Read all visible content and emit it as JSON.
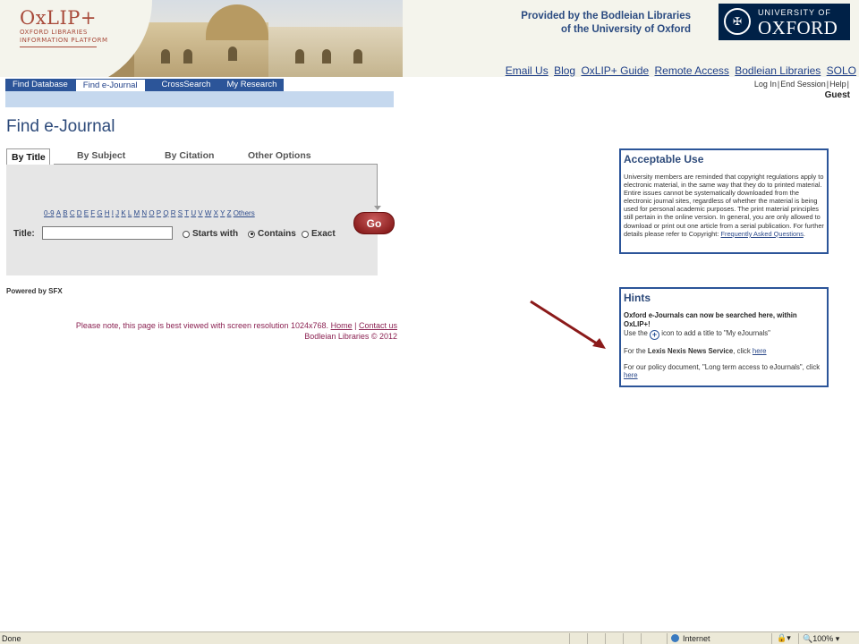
{
  "header": {
    "logo_main": "OxLIP+",
    "logo_sub1": "OXFORD LIBRARIES",
    "logo_sub2": "INFORMATION PLATFORM",
    "provided_line1": "Provided by the Bodleian Libraries",
    "provided_line2": "of the University of Oxford",
    "oxford_uni": "UNIVERSITY OF",
    "oxford_name": "OXFORD",
    "links": [
      "Email Us",
      "Blog",
      "OxLIP+ Guide",
      "Remote Access",
      "Bodleian Libraries",
      "SOLO"
    ]
  },
  "nav": {
    "tabs": [
      "Find Database",
      "Find e-Journal",
      "CrossSearch",
      "My Research"
    ],
    "active": "Find e-Journal"
  },
  "session": {
    "login": "Log In",
    "end_session": "End Session",
    "help": "Help",
    "user": "Guest"
  },
  "main": {
    "page_title": "Find e-Journal",
    "search_tabs": [
      "By Title",
      "By Subject",
      "By Citation",
      "Other Options"
    ],
    "alpha_links": [
      "0-9",
      "A",
      "B",
      "C",
      "D",
      "E",
      "F",
      "G",
      "H",
      "I",
      "J",
      "K",
      "L",
      "M",
      "N",
      "O",
      "P",
      "Q",
      "R",
      "S",
      "T",
      "U",
      "V",
      "W",
      "X",
      "Y",
      "Z",
      "Others"
    ],
    "title_label": "Title:",
    "title_value": "",
    "radio_options": [
      "Starts with",
      "Contains",
      "Exact"
    ],
    "radio_selected": "Contains",
    "go_label": "Go",
    "powered_by": "Powered by SFX",
    "note_text": "Please note, this page is best viewed with screen resolution 1024x768.",
    "note_home": "Home",
    "note_contact": "Contact us",
    "copyright": "Bodleian Libraries © 2012"
  },
  "acceptable_use": {
    "title": "Acceptable Use",
    "body": "University members are reminded that copyright regulations apply to electronic material, in the same way that they do to printed material. Entire issues cannot be systematically downloaded from the electronic journal sites, regardless of whether the material is being used for personal academic purposes. The print material principles still pertain in the online version. In general, you are only allowed to download or print out one article from a serial publication. For further details please refer to Copyright:",
    "faq_link": "Frequently Asked Questions"
  },
  "hints": {
    "title": "Hints",
    "bold_line": "Oxford e-Journals can now be searched here, within OxLIP+!",
    "use_prefix": "Use the",
    "use_suffix": "icon to add a title to \"My eJournals\"",
    "lexis_prefix": "For the",
    "lexis_bold": "Lexis Nexis News Service",
    "lexis_mid": ", click",
    "lexis_link": "here",
    "policy_text": "For our policy document, \"Long term access to eJournals\", click",
    "policy_link": "here"
  },
  "statusbar": {
    "status": "Done",
    "zone": "Internet",
    "zoom": "100%"
  },
  "colors": {
    "nav_blue": "#2c5599",
    "accent_red": "#8b2252",
    "arrow_red": "#8b1a1a"
  }
}
